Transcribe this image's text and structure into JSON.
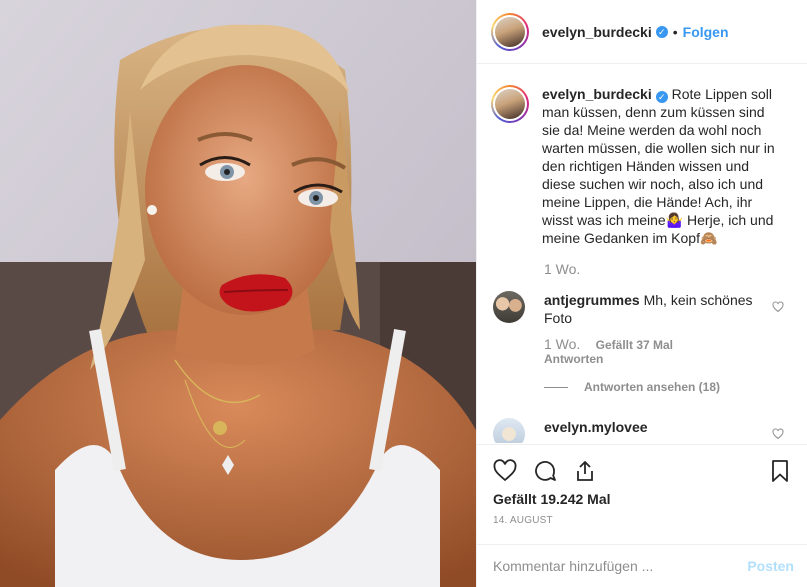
{
  "post": {
    "username": "evelyn_burdecki",
    "follow_label": "Folgen",
    "separator": "•",
    "caption": "Rote Lippen soll man küssen, denn zum küssen sind sie da! Meine werden da wohl noch warten müssen, die wollen sich nur in den richtigen Händen wissen und diese suchen wir noch, also ich und meine Lippen, die Hände! Ach, ihr wisst was ich meine🤷‍♀️ Herje, ich und meine Gedanken im Kopf🙈",
    "age": "1 Wo.",
    "likes": "Gefällt 19.242 Mal",
    "date": "14. AUGUST"
  },
  "comments": [
    {
      "username": "antjegrummes",
      "text": "Mh, kein schönes Foto",
      "age": "1 Wo.",
      "likes": "Gefällt 37 Mal",
      "reply_label": "Antworten",
      "view_replies": "Antworten ansehen (18)"
    },
    {
      "username": "evelyn.mylovee",
      "text": ""
    }
  ],
  "comment_box": {
    "placeholder": "Kommentar hinzufügen ...",
    "post_label": "Posten"
  },
  "icons": [
    "heart-icon",
    "comment-icon",
    "share-icon",
    "bookmark-icon",
    "verified-badge-icon"
  ],
  "colors": {
    "accent": "#3897f0",
    "muted": "#8e8e8e",
    "post_disabled": "#b2dffc"
  }
}
